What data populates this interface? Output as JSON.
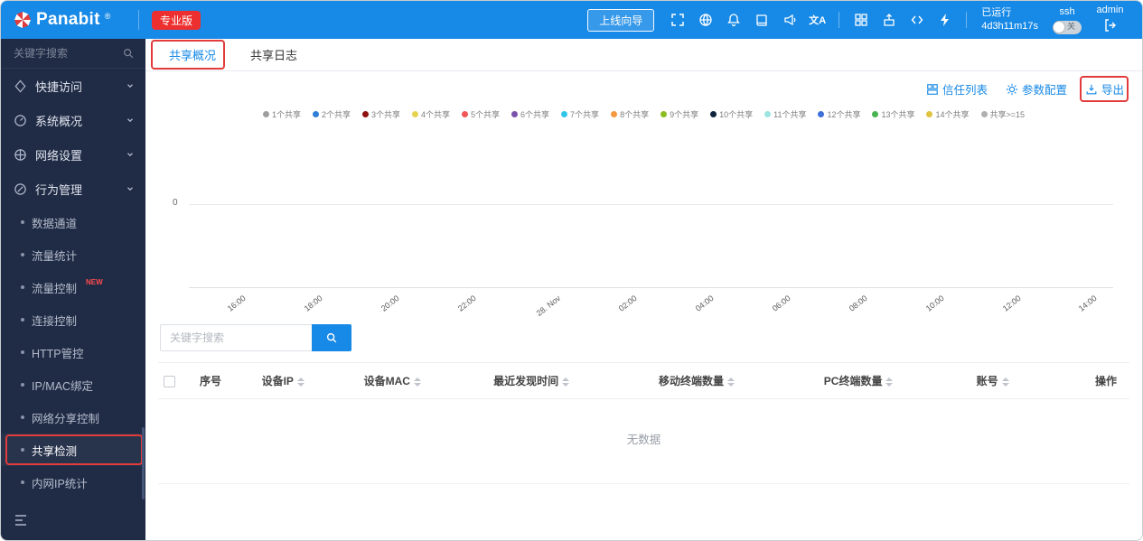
{
  "topbar": {
    "brand": "Panabit",
    "brand_mark": "®",
    "edition_badge": "专业版",
    "wizard_button": "上线向导",
    "translate_icon_text": "文A",
    "uptime_label": "已运行",
    "uptime_value": "4d3h11m17s",
    "ssh_label": "ssh",
    "ssh_toggle_state": "关",
    "username": "admin",
    "bar_color": "#1789e6"
  },
  "sidebar": {
    "search_placeholder": "关键字搜索",
    "groups": [
      {
        "label": "快捷访问"
      },
      {
        "label": "系统概况"
      },
      {
        "label": "网络设置"
      },
      {
        "label": "行为管理"
      }
    ],
    "behavior_items": [
      {
        "label": "数据通道"
      },
      {
        "label": "流量统计"
      },
      {
        "label": "流量控制",
        "badge": "NEW"
      },
      {
        "label": "连接控制"
      },
      {
        "label": "HTTP管控"
      },
      {
        "label": "IP/MAC绑定"
      },
      {
        "label": "网络分享控制"
      },
      {
        "label": "共享检测",
        "active": true,
        "annotated": true
      },
      {
        "label": "内网IP统计"
      }
    ]
  },
  "main": {
    "tabs": [
      {
        "label": "共享概况",
        "active": true,
        "annotated": true
      },
      {
        "label": "共享日志",
        "active": false
      }
    ],
    "toolbar": {
      "trust_list": "信任列表",
      "params_config": "参数配置",
      "export": "导出"
    },
    "search_placeholder": "关键字搜索",
    "table": {
      "columns": [
        {
          "label": "序号",
          "sortable": false
        },
        {
          "label": "设备IP",
          "sortable": true
        },
        {
          "label": "设备MAC",
          "sortable": true
        },
        {
          "label": "最近发现时间",
          "sortable": true
        },
        {
          "label": "移动终端数量",
          "sortable": true
        },
        {
          "label": "PC终端数量",
          "sortable": true
        },
        {
          "label": "账号",
          "sortable": true
        },
        {
          "label": "操作",
          "sortable": false,
          "align": "right"
        }
      ],
      "empty_text": "无数据"
    }
  },
  "chart_data": {
    "type": "line",
    "title": "",
    "legend_position": "top",
    "grid": true,
    "y_ticks": [
      "0"
    ],
    "x_ticks": [
      "16:00",
      "18:00",
      "20:00",
      "22:00",
      "28. Nov",
      "02:00",
      "04:00",
      "06:00",
      "08:00",
      "10:00",
      "12:00",
      "14:00"
    ],
    "series": [
      {
        "name": "1个共享",
        "color": "#9e9e9e",
        "values": []
      },
      {
        "name": "2个共享",
        "color": "#2f7ed8",
        "values": []
      },
      {
        "name": "3个共享",
        "color": "#8f1010",
        "values": []
      },
      {
        "name": "4个共享",
        "color": "#e6d450",
        "values": []
      },
      {
        "name": "5个共享",
        "color": "#f25656",
        "values": []
      },
      {
        "name": "6个共享",
        "color": "#7b52ab",
        "values": []
      },
      {
        "name": "7个共享",
        "color": "#31c5e8",
        "values": []
      },
      {
        "name": "8个共享",
        "color": "#f5983f",
        "values": []
      },
      {
        "name": "9个共享",
        "color": "#8bbc21",
        "values": []
      },
      {
        "name": "10个共享",
        "color": "#0d233a",
        "values": []
      },
      {
        "name": "11个共享",
        "color": "#9ae5e0",
        "values": []
      },
      {
        "name": "12个共享",
        "color": "#3f6fd8",
        "values": []
      },
      {
        "name": "13个共享",
        "color": "#46b450",
        "values": []
      },
      {
        "name": "14个共享",
        "color": "#e0c341",
        "values": []
      },
      {
        "name": "共享>=15",
        "color": "#b0b0b0",
        "values": []
      }
    ]
  },
  "annotation_color": "#e23b3b"
}
